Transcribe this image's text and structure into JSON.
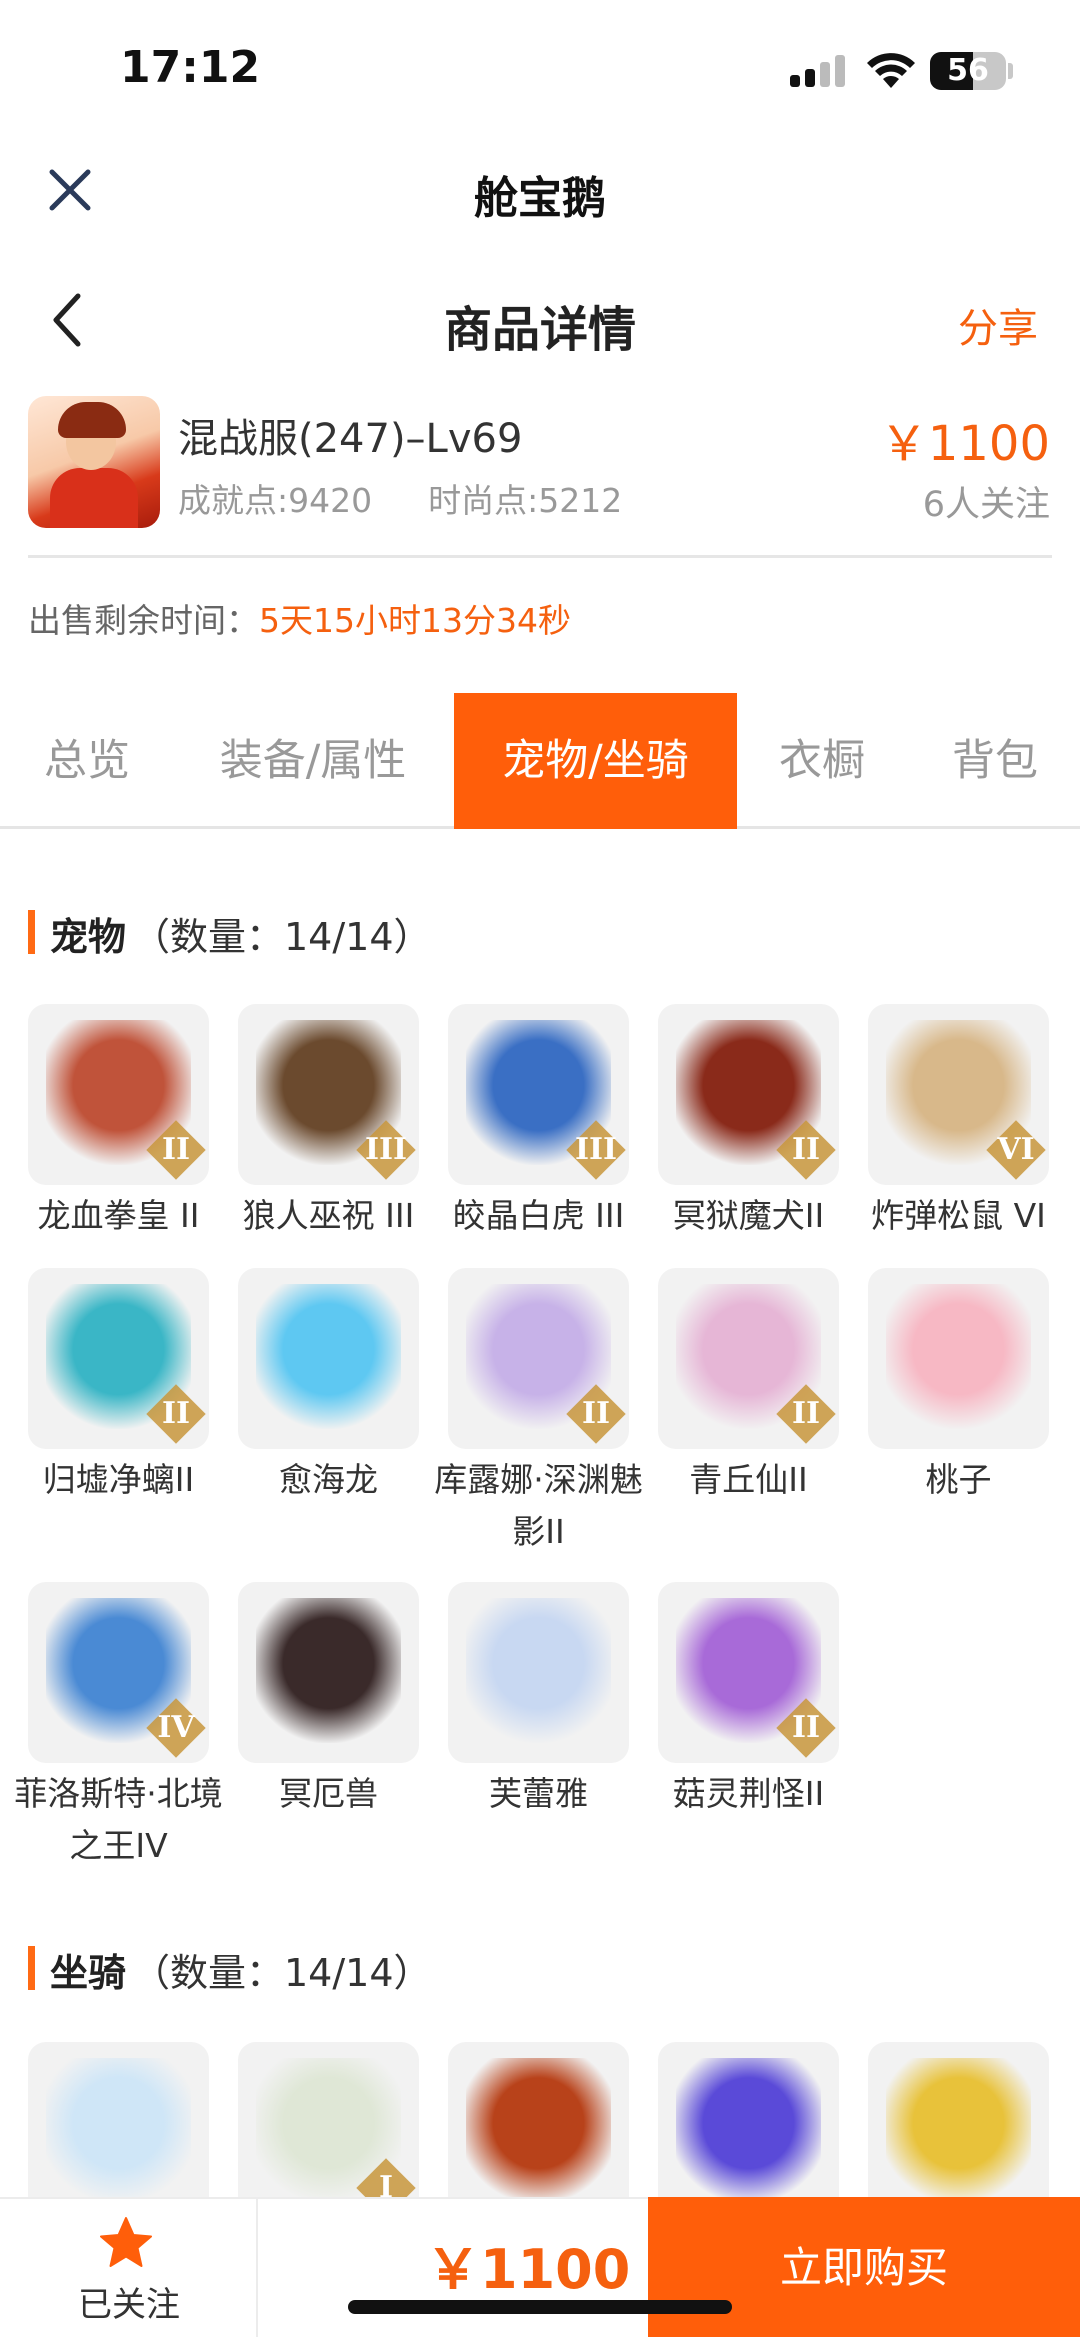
{
  "status_bar": {
    "time": "17:12",
    "battery": "56",
    "battery_level": 0.56
  },
  "topbar": {
    "title": "舱宝鹅"
  },
  "navbar": {
    "title": "商品详情",
    "share_label": "分享"
  },
  "product": {
    "server": "混战服(247)–Lv69",
    "achievement": "成就点:9420",
    "fashion": "时尚点:5212",
    "price": "￥1100",
    "followers": "6人关注"
  },
  "sale": {
    "remaining_label": "出售剩余时间：",
    "remaining_value": "5天15小时13分34秒"
  },
  "tabs": [
    "总览",
    "装备/属性",
    "宠物/坐骑",
    "衣橱",
    "背包"
  ],
  "active_tab": "宠物/坐骑",
  "pets_section": {
    "title": "宠物",
    "count": "（数量：14/14）"
  },
  "pets": [
    {
      "name": "龙血拳皇 II",
      "tier": "II",
      "color": "#c0533a"
    },
    {
      "name": "狼人巫祝 III",
      "tier": "III",
      "color": "#6b4a2e"
    },
    {
      "name": "皎晶白虎 III",
      "tier": "III",
      "color": "#3a6fc4"
    },
    {
      "name": "冥狱魔犬II",
      "tier": "II",
      "color": "#8a2a1a"
    },
    {
      "name": "炸弹松鼠 VI",
      "tier": "VI",
      "color": "#d8b88a"
    },
    {
      "name": "归墟净螭II",
      "tier": "II",
      "color": "#3ab6c6"
    },
    {
      "name": "愈海龙",
      "tier": "",
      "color": "#5ec8f2"
    },
    {
      "name": "库露娜·深渊魅影II",
      "tier": "II",
      "color": "#c7b2e8"
    },
    {
      "name": "青丘仙II",
      "tier": "II",
      "color": "#e6b6d6"
    },
    {
      "name": "桃子",
      "tier": "",
      "color": "#f7b8c4"
    },
    {
      "name": "菲洛斯特·北境之王IV",
      "tier": "IV",
      "color": "#4a8ad4"
    },
    {
      "name": "冥厄兽",
      "tier": "",
      "color": "#3a2a2a"
    },
    {
      "name": "芙蕾雅",
      "tier": "",
      "color": "#c8d8f2"
    },
    {
      "name": "菇灵荆怪II",
      "tier": "II",
      "color": "#a86ad8"
    }
  ],
  "mounts_section": {
    "title": "坐骑",
    "count": "（数量：14/14）"
  },
  "mounts": [
    {
      "tier": "",
      "color": "#cfe6f7"
    },
    {
      "tier": "I",
      "color": "#dfe7d6"
    },
    {
      "tier": "",
      "color": "#b8421a"
    },
    {
      "tier": "",
      "color": "#5a4ad8"
    },
    {
      "tier": "",
      "color": "#e8c23a"
    }
  ],
  "bottom_bar": {
    "follow_label": "已关注",
    "price": "￥1100",
    "buy_label": "立即购买"
  },
  "colors": {
    "accent": "#ff5e0a",
    "price": "#f5600f"
  }
}
